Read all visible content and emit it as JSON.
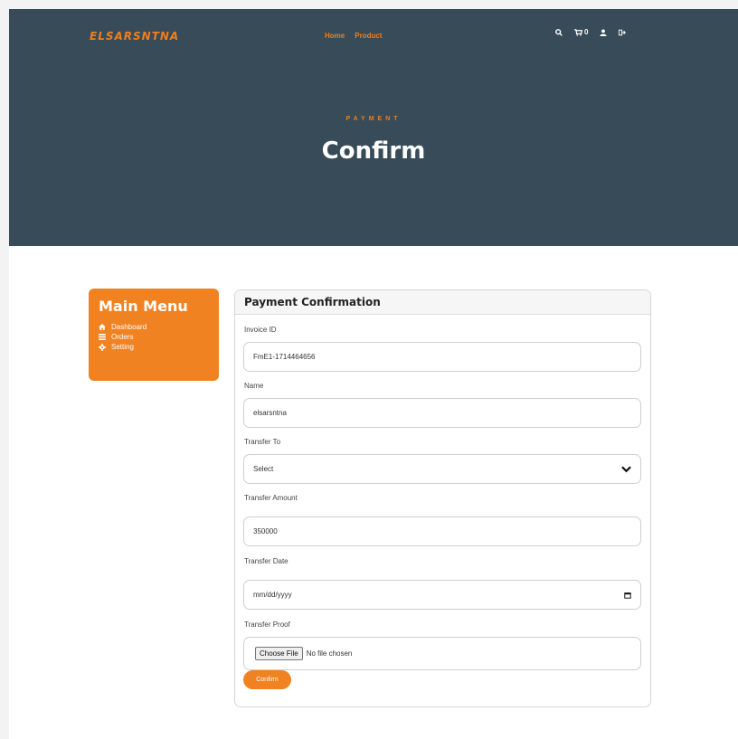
{
  "header": {
    "logo": "ELSARSNTNA",
    "nav": [
      "Home",
      "Product"
    ],
    "cart_count": "0",
    "eyebrow": "PAYMENT",
    "title": "Confirm"
  },
  "sidebar": {
    "title": "Main Menu",
    "items": [
      {
        "label": "Dashboard",
        "icon": "home-icon"
      },
      {
        "label": "Orders",
        "icon": "list-icon"
      },
      {
        "label": "Setting",
        "icon": "gear-icon"
      }
    ]
  },
  "form": {
    "title": "Payment Confirmation",
    "invoice_label": "Invoice ID",
    "invoice_value": "FmE1-1714464656",
    "name_label": "Name",
    "name_value": "elsarsntna",
    "transfer_to_label": "Transfer To",
    "transfer_to_value": "Select",
    "amount_label": "Transfer Amount",
    "amount_value": "350000",
    "date_label": "Transfer Date",
    "date_placeholder": "mm/dd/yyyy",
    "proof_label": "Transfer Proof",
    "proof_button": "Choose File",
    "proof_status": "No file chosen",
    "submit_label": "Confirm"
  },
  "colors": {
    "accent": "#f08221",
    "hero_bg": "#384b58"
  }
}
